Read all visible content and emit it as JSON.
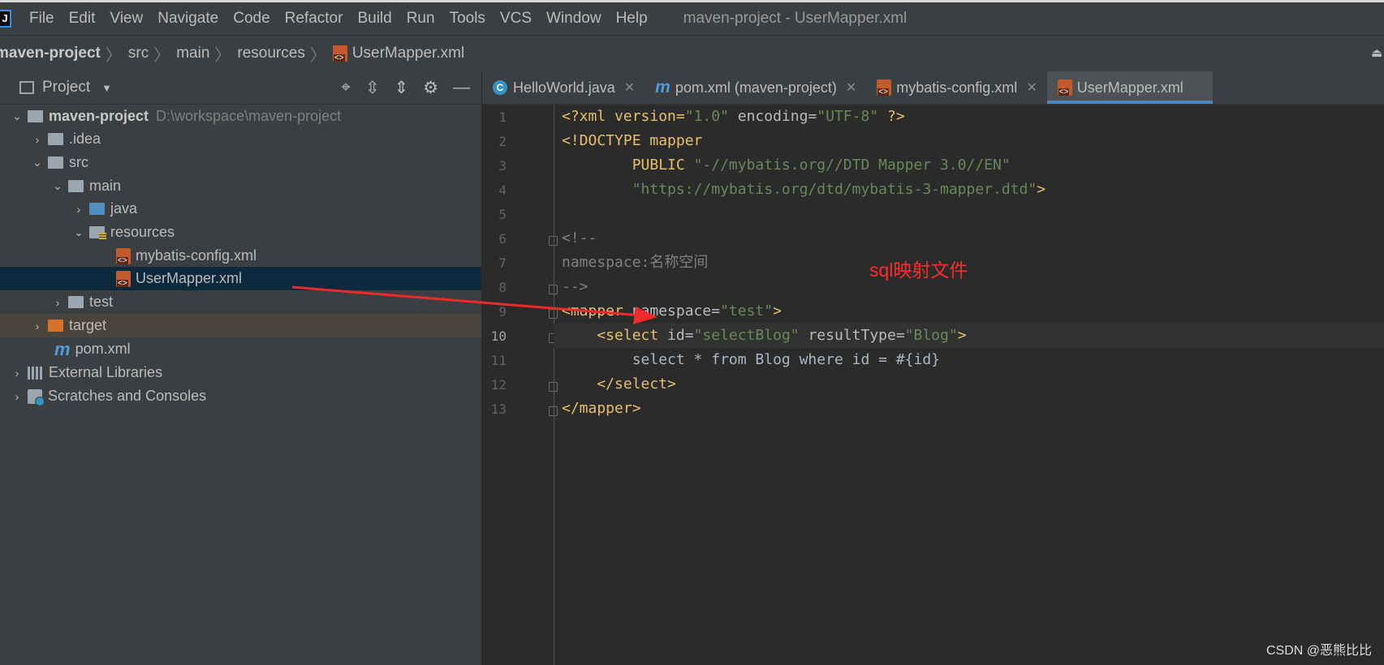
{
  "window": {
    "title": "maven-project - UserMapper.xml",
    "menu": [
      "File",
      "Edit",
      "View",
      "Navigate",
      "Code",
      "Refactor",
      "Build",
      "Run",
      "Tools",
      "VCS",
      "Window",
      "Help"
    ],
    "app_icon_glyph": "J"
  },
  "breadcrumb": [
    "maven-project",
    "src",
    "main",
    "resources",
    "UserMapper.xml"
  ],
  "project_panel": {
    "title": "Project",
    "tree": [
      {
        "label": "maven-project",
        "hint": "D:\\workspace\\maven-project",
        "depth": 0,
        "icon": "module-folder-icon",
        "expanded": true
      },
      {
        "label": ".idea",
        "depth": 1,
        "icon": "folder-icon",
        "expanded": false
      },
      {
        "label": "src",
        "depth": 1,
        "icon": "folder-icon",
        "expanded": true
      },
      {
        "label": "main",
        "depth": 2,
        "icon": "folder-icon",
        "expanded": true
      },
      {
        "label": "java",
        "depth": 3,
        "icon": "source-folder-icon",
        "expanded": false
      },
      {
        "label": "resources",
        "depth": 3,
        "icon": "resources-folder-icon",
        "expanded": true
      },
      {
        "label": "mybatis-config.xml",
        "depth": 4,
        "icon": "xml-file-icon"
      },
      {
        "label": "UserMapper.xml",
        "depth": 4,
        "icon": "xml-file-icon",
        "selected": true
      },
      {
        "label": "test",
        "depth": 2,
        "icon": "folder-icon",
        "expanded": false
      },
      {
        "label": "target",
        "depth": 1,
        "icon": "excluded-folder-icon",
        "expanded": false
      },
      {
        "label": "pom.xml",
        "depth": 1,
        "icon": "maven-icon"
      },
      {
        "label": "External Libraries",
        "depth": 0,
        "icon": "libraries-icon",
        "expanded": false
      },
      {
        "label": "Scratches and Consoles",
        "depth": 0,
        "icon": "scratches-icon",
        "expanded": false
      }
    ]
  },
  "tabs": [
    {
      "label": "HelloWorld.java",
      "icon": "java-class-icon"
    },
    {
      "label": "pom.xml (maven-project)",
      "icon": "maven-icon"
    },
    {
      "label": "mybatis-config.xml",
      "icon": "xml-file-icon"
    },
    {
      "label": "UserMapper.xml",
      "icon": "xml-file-icon",
      "active": true
    }
  ],
  "editor": {
    "line_numbers": [
      "1",
      "2",
      "3",
      "4",
      "5",
      "6",
      "7",
      "8",
      "9",
      "10",
      "11",
      "12",
      "13"
    ],
    "current_line": 10,
    "lines": {
      "l1_a": "<?xml version=",
      "l1_b": "\"1.0\"",
      "l1_c": " encoding=",
      "l1_d": "\"UTF-8\"",
      "l1_e": " ?>",
      "l2": "<!DOCTYPE mapper",
      "l3_a": "        PUBLIC ",
      "l3_b": "\"-//mybatis.org//DTD Mapper 3.0//EN\"",
      "l4_a": "        ",
      "l4_b": "\"https://mybatis.org/dtd/mybatis-3-mapper.dtd\"",
      "l4_c": ">",
      "l5": "",
      "l6": "<!--",
      "l7": "namespace:名称空间",
      "l8": "-->",
      "l9_a": "<mapper",
      "l9_b": " namespace=",
      "l9_c": "\"test\"",
      "l9_d": ">",
      "l10_a": "    <select",
      "l10_b": " id=",
      "l10_c": "\"selectBlog\"",
      "l10_d": " resultType=",
      "l10_e": "\"Blog\"",
      "l10_f": ">",
      "l11": "        select * from Blog where id = #{id}",
      "l12": "    </select>",
      "l13": "</mapper>"
    }
  },
  "annotation": {
    "text": "sql映射文件",
    "color": "#ff2b2b"
  },
  "watermark": "CSDN @恶熊比比",
  "colors": {
    "tag": "#e8bf6a",
    "value": "#6a8759",
    "comment": "#808080",
    "selection": "#0d293e",
    "tab_underline": "#4a88c7"
  }
}
